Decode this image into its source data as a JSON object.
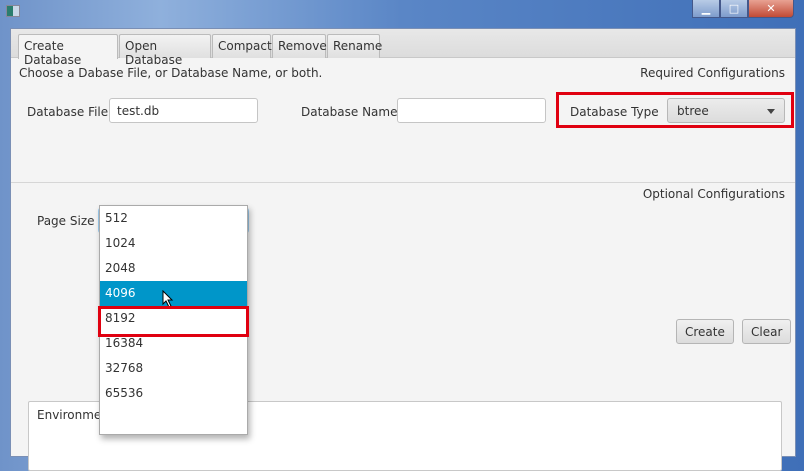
{
  "window": {
    "minimize": "▁",
    "maximize": "□",
    "close": "✕"
  },
  "tabs": [
    {
      "label": "Create Database"
    },
    {
      "label": "Open Database"
    },
    {
      "label": "Compact"
    },
    {
      "label": "Remove"
    },
    {
      "label": "Rename"
    }
  ],
  "required": {
    "instruction": "Choose a Dabase File, or Database Name, or both.",
    "heading": "Required Configurations",
    "db_file_label": "Database File",
    "db_file_value": "test.db",
    "db_name_label": "Database Name",
    "db_name_value": "",
    "db_type_label": "Database Type",
    "db_type_value": "btree"
  },
  "optional": {
    "heading": "Optional Configurations",
    "page_size_label": "Page Size",
    "page_size_value": "",
    "page_size_options": [
      "512",
      "1024",
      "2048",
      "4096",
      "8192",
      "16384",
      "32768",
      "65536"
    ],
    "highlighted_option": "4096"
  },
  "buttons": {
    "create": "Create",
    "clear": "Clear"
  },
  "environment_label": "Environment",
  "colors": {
    "highlight": "#0096c9",
    "annotation": "#e00010"
  }
}
